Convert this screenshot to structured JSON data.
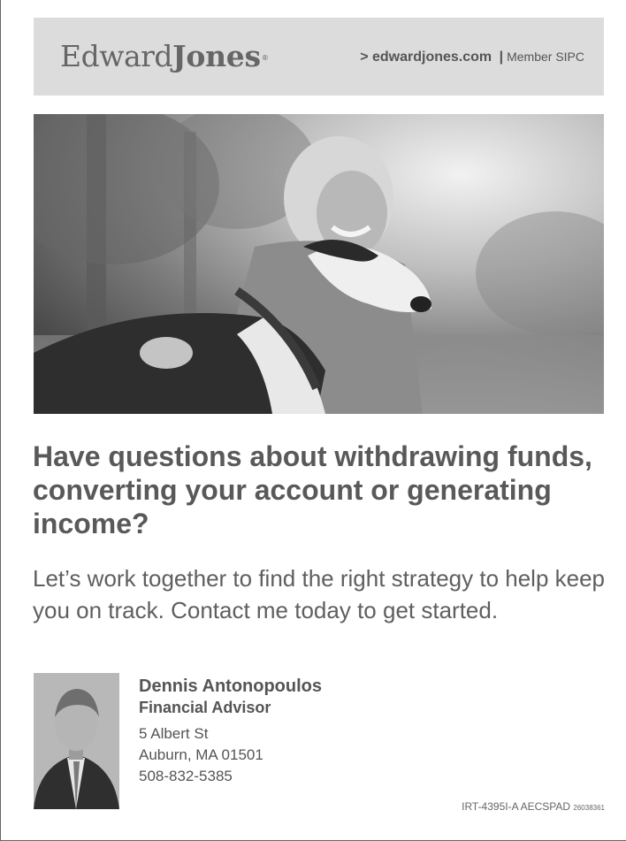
{
  "header": {
    "brand_first": "Edward",
    "brand_second": "Jones",
    "brand_mark": "®",
    "website": "> edwardjones.com",
    "separator": "|",
    "member": "Member SIPC"
  },
  "hero_image": {
    "description_icon": "photo-woman-hugging-dog"
  },
  "headline": "Have questions about withdrawing funds, converting your account or generating income?",
  "subtext": "Let’s work together to find the right strategy to help keep you on track. Contact me today to get started.",
  "advisor": {
    "name": "Dennis Antonopoulos",
    "title": "Financial Advisor",
    "address_line1": "5 Albert St",
    "address_line2": "Auburn, MA 01501",
    "phone": "508-832-5385"
  },
  "footer": {
    "code": "IRT-4395I-A AECSPAD",
    "number": "26038361"
  },
  "colors": {
    "header_bg": "#dcdcdc",
    "text": "#595959"
  }
}
